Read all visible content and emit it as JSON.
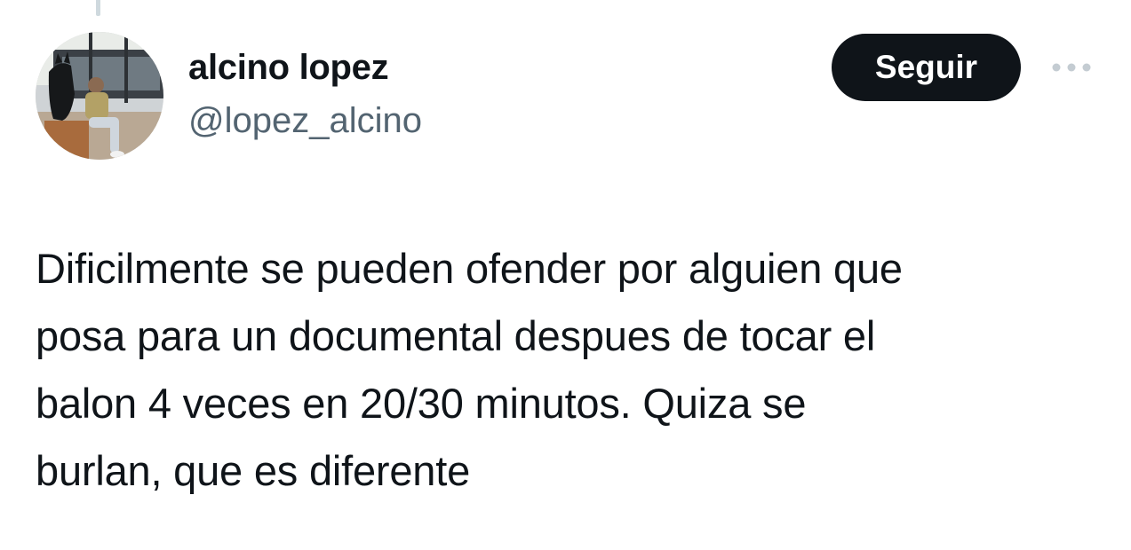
{
  "tweet": {
    "author": {
      "display_name": "alcino lopez",
      "handle": "@lopez_alcino",
      "avatar_icon": "profile-photo-icon"
    },
    "follow_label": "Seguir",
    "more_icon": "more-options-icon",
    "text": "Dificilmente se pueden ofender por alguien que\nposa para un documental despues de tocar el\nbalon 4 veces en 20/30 minutos. Quiza se\nburlan, que es diferente"
  },
  "colors": {
    "text_primary": "#0f1419",
    "text_secondary": "#536471",
    "follow_button_bg": "#0f1419",
    "follow_button_text": "#ffffff",
    "thread_line": "#cfd9de"
  }
}
